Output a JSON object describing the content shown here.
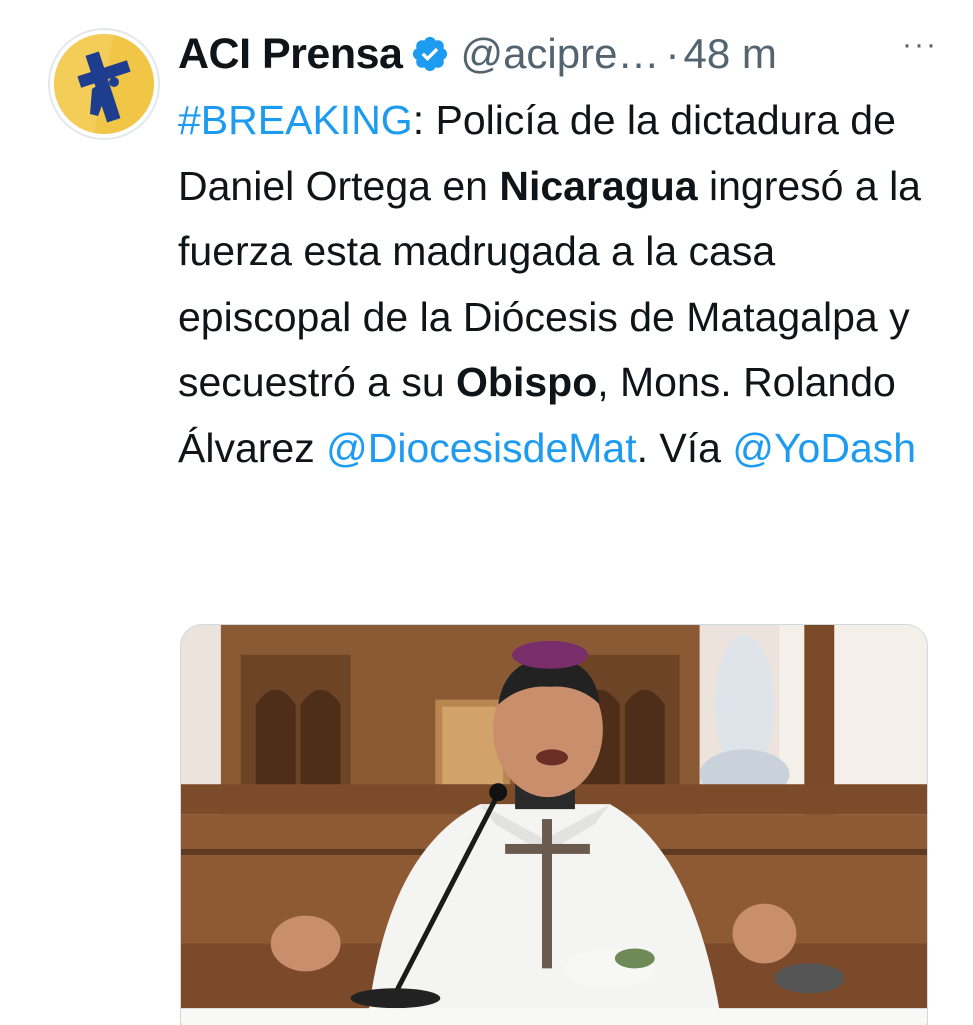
{
  "tweet": {
    "author": {
      "name": "ACI Prensa",
      "handle": "@acipre…",
      "verified_icon": "verified-badge-icon",
      "avatar_icon": "aci-prensa-logo"
    },
    "separator": "·",
    "time": "48 m",
    "more_icon": "ellipsis-icon",
    "text": {
      "hashtag": "#BREAKING",
      "t1": ": Policía de la dictadura de Daniel Ortega en ",
      "bold1": "Nicaragua",
      "t2": " ingresó a la fuerza esta madrugada a la casa episcopal de la Diócesis de Matagalpa y secuestró a su ",
      "bold2": "Obispo",
      "t3": ", Mons. Rolando Álvarez ",
      "mention1": "@DiocesisdeMat",
      "t4": ". Vía ",
      "mention2": "@YoDash"
    },
    "media": {
      "kind": "photo",
      "subject": "bishop-speaking-at-altar"
    },
    "colors": {
      "link": "#1d9bf0",
      "secondary": "#536471",
      "primary": "#0f1419",
      "avatar_bg": "#f1c646"
    }
  }
}
